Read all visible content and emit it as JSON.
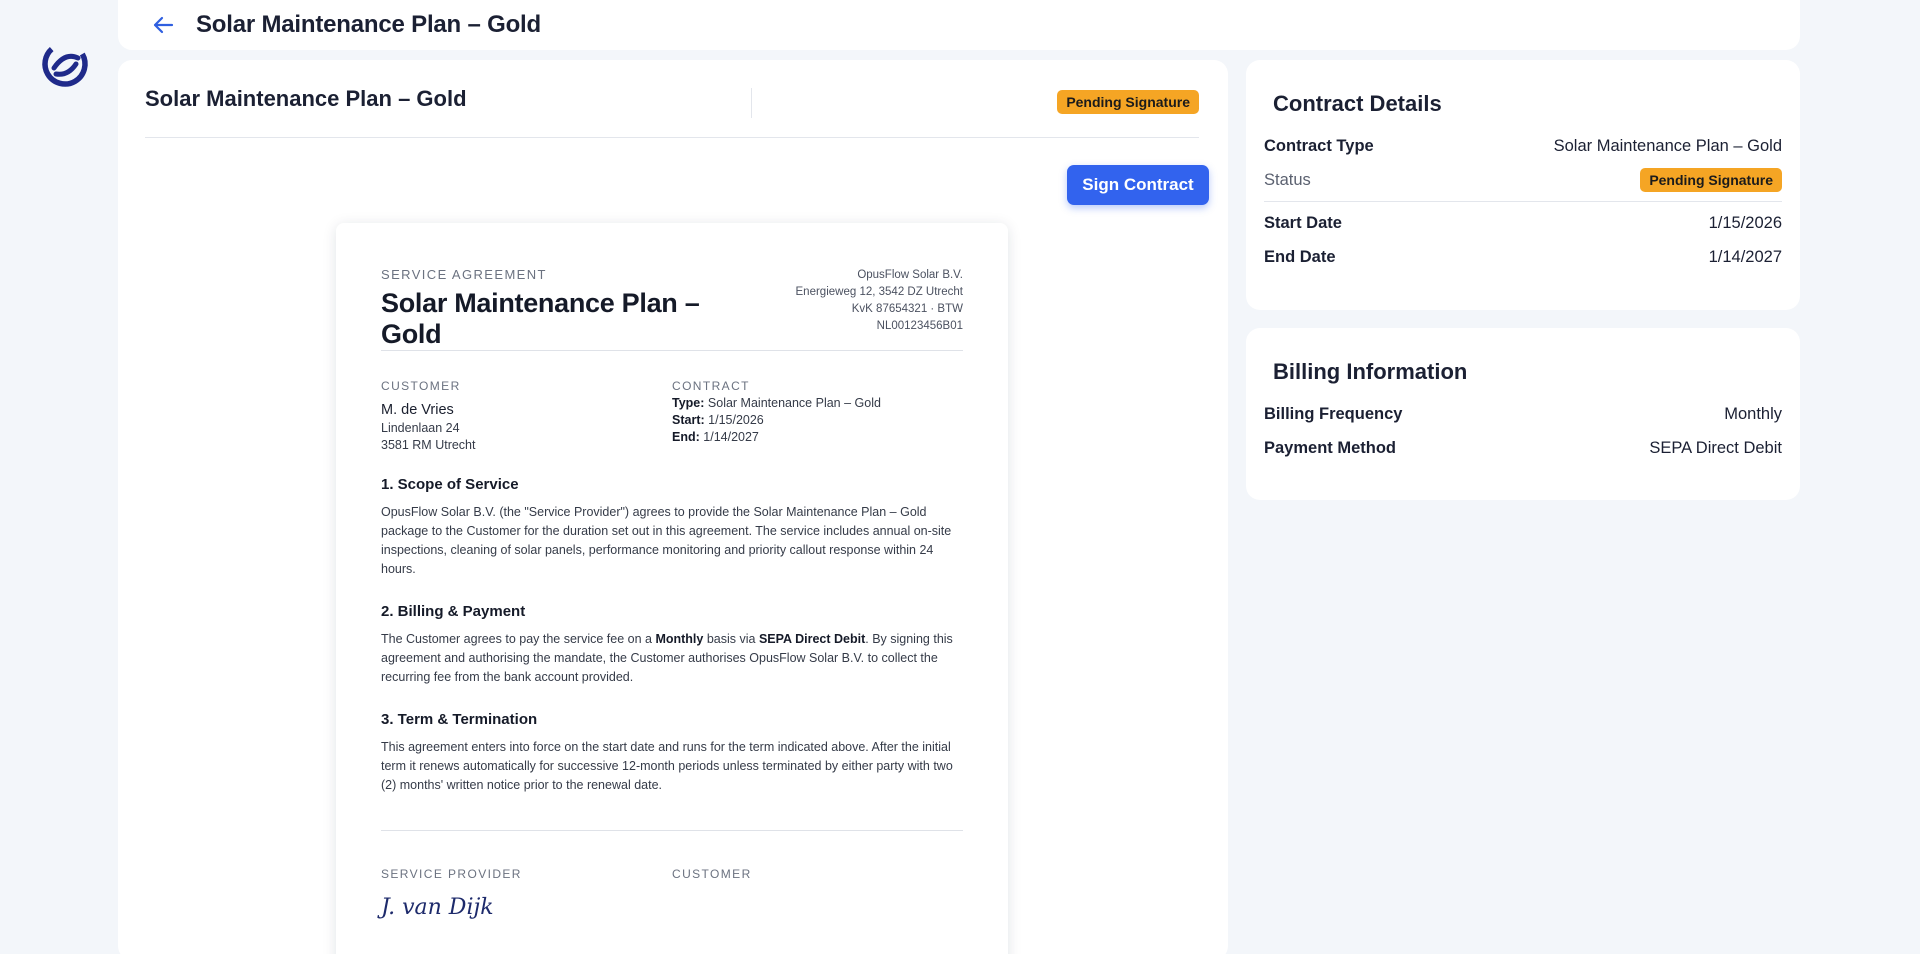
{
  "header": {
    "title": "Solar Maintenance Plan – Gold"
  },
  "panel": {
    "title": "Solar Maintenance Plan – Gold",
    "status": "Pending Signature",
    "sign_label": "Sign Contract"
  },
  "document": {
    "eyebrow": "SERVICE AGREEMENT",
    "title": "Solar Maintenance Plan – Gold",
    "provider": {
      "name": "OpusFlow Solar B.V.",
      "address": "Energieweg 12, 3542 DZ Utrecht",
      "ids": "KvK 87654321 · BTW NL00123456B01"
    },
    "customer": {
      "heading": "CUSTOMER",
      "name": "M. de Vries",
      "street": "Lindenlaan 24",
      "city": "3581 RM Utrecht"
    },
    "contract": {
      "heading": "CONTRACT",
      "type_label": "Type:",
      "type": "Solar Maintenance Plan – Gold",
      "start_label": "Start:",
      "start": "1/15/2026",
      "end_label": "End:",
      "end": "1/14/2027"
    },
    "sections": [
      {
        "heading": "1. Scope of Service",
        "text": "OpusFlow Solar B.V. (the \"Service Provider\") agrees to provide the Solar Maintenance Plan – Gold package to the Customer for the duration set out in this agreement. The service includes annual on-site inspections, cleaning of solar panels, performance monitoring and priority callout response within 24 hours."
      },
      {
        "heading": "2. Billing & Payment",
        "text_a": "The Customer agrees to pay the service fee on a ",
        "bold_a": "Monthly",
        "text_b": " basis via ",
        "bold_b": "SEPA Direct Debit",
        "text_c": ". By signing this agreement and authorising the mandate, the Customer authorises OpusFlow Solar B.V. to collect the recurring fee from the bank account provided."
      },
      {
        "heading": "3. Term & Termination",
        "text": "This agreement enters into force on the start date and runs for the term indicated above. After the initial term it renews automatically for successive 12-month periods unless terminated by either party with two (2) months' written notice prior to the renewal date."
      }
    ],
    "signatures": {
      "provider_heading": "SERVICE PROVIDER",
      "provider_signature": "J. van Dijk",
      "customer_heading": "CUSTOMER"
    }
  },
  "contract_details": {
    "title": "Contract Details",
    "type_label": "Contract Type",
    "type_value": "Solar Maintenance Plan – Gold",
    "status_label": "Status",
    "status_value": "Pending Signature",
    "start_label": "Start Date",
    "start_value": "1/15/2026",
    "end_label": "End Date",
    "end_value": "1/14/2027"
  },
  "billing": {
    "title": "Billing Information",
    "frequency_label": "Billing Frequency",
    "frequency_value": "Monthly",
    "method_label": "Payment Method",
    "method_value": "SEPA Direct Debit"
  },
  "colors": {
    "accent": "#3263ee",
    "badge": "#f5a524",
    "logo": "#1f2a8a"
  },
  "icons": {
    "logo": "opusflow-logo-icon",
    "back": "arrow-left-icon"
  }
}
